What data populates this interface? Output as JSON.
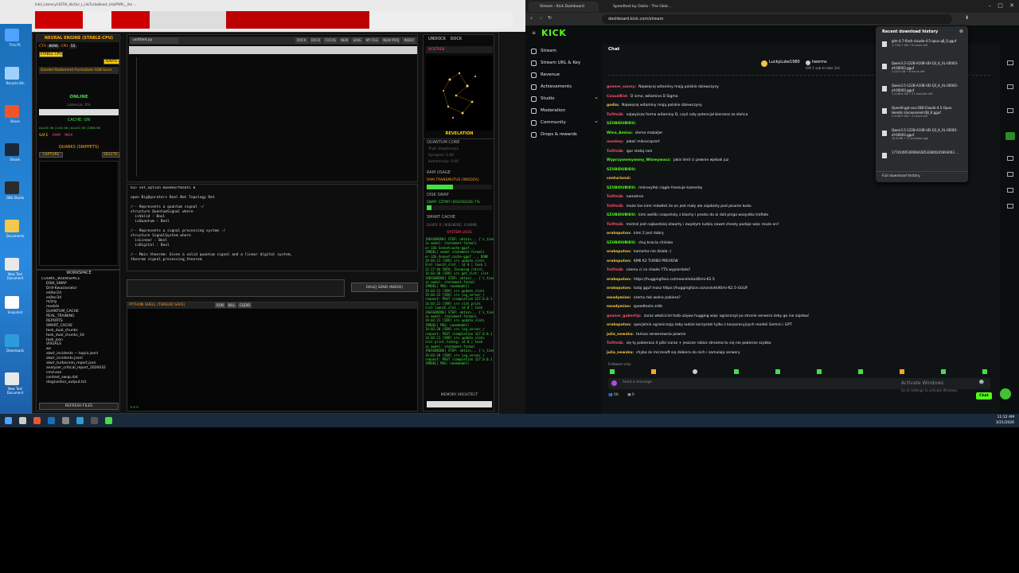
{
  "desktop": {
    "top_strip_text": "Intel_Latency/ULTRA_4k/Qsc_L_hk/TurboBoost_Lhb/PWR/__lite ..."
  },
  "desktop_icons": [
    {
      "label": "This PC",
      "color": "#4fa3ff"
    },
    {
      "label": "Recycle Bin",
      "color": "#9fd0ff"
    },
    {
      "label": "Brave",
      "color": "#f0542d"
    },
    {
      "label": "Steam",
      "color": "#1b2838"
    },
    {
      "label": "OBS Studio",
      "color": "#2b2b2b"
    },
    {
      "label": "Documents",
      "color": "#f2c94c"
    },
    {
      "label": "New Text Document",
      "color": "#e8e8e8"
    },
    {
      "label": "Snapshot",
      "color": "#ffffff"
    },
    {
      "label": "Downloads",
      "color": "#2d9cdb"
    },
    {
      "label": "New Text Document",
      "color": "#e8e8e8"
    }
  ],
  "workspace_app": {
    "neural_engine_title": "NEURAL ENGINE (STABLE-CPU)",
    "cpu_label": "CPU",
    "cpu_value": "55",
    "ctx_label": "CTX",
    "ctx_value": "8096",
    "stable_cpu": "STABLE CPU",
    "ignite": "IGNITE",
    "model_name": "Goedel-Statement-Formalizer-32B-Sonn",
    "status": "ONLINE",
    "latency": "Latencja: 0%",
    "cache_on": "CACHE: ON",
    "cache_stats": "ALLOC 0K  | LOG 0K | ALLOC 0K | DISK 0K",
    "safe": "SAFE",
    "ram": "RAM",
    "max": "MAX",
    "quarks_title": "QUARKS (SNIPPETS)",
    "capture": "CAPTURE",
    "delete": "DELETE",
    "workspace_title": "WORKSPACE",
    "tree": [
      "COSMIC_WORKSPACE",
      "DISK_SWAP",
      "Drill-Kwazionator",
      "editor2d",
      "editor3d",
      "m/zrg",
      "models",
      "QUANTUM_CACHE",
      "REAL_TRAINING",
      "REPORTS",
      "SMART_CACHE",
      "task_dual_chunks",
      "task_dual_chunks_3d",
      "task_json",
      "VISUALS",
      "ws",
      "alw/r_incidents — kopia.jsonl",
      "alw/r_incidents.jsonl",
      "alw/r_turbocsan_report.json",
      "analyzer_critical_report_2026032",
      "cmd.exe",
      "context_swap.dat",
      "diagnostics_output.txt"
    ],
    "refresh_files": "REFRESH FILES",
    "editor_tab": "untitled.py",
    "editor_buttons": [
      "DOCK",
      "DOCK",
      "FOCUS",
      "NEW",
      "SAVE",
      "MY FILE",
      "NEW PROJ",
      "INDEX"
    ],
    "lean_lines": [
      "AI> set_option maxHeartbeats 0",
      "",
      "open BigOperators Real Nat Topology Rat",
      "",
      "/-- Represents a quantum signal -/",
      "structure QuantumSignal where",
      "  isValid : Bool",
      "  isQuantum : Bool",
      "",
      "/-- Represents a signal processing system -/",
      "structure SignalSystem where",
      "  isLinear : Bool",
      "  isDigital : Bool",
      "",
      "/-- Main theorem: Given a valid quantum signal and a linear digital system,",
      "theorem signal_processing_theorem"
    ],
    "send_button": "DALEJ SEND (NDOO)",
    "shell_title": "PYTHON SHELL (THREAD SAFE)",
    "shell_buttons": [
      "RUN",
      "KILL",
      "CLEAR"
    ],
    "shell_prompt": ">>>",
    "undock": "UNDOCK",
    "dock": "DOCK",
    "actions": "ACKTREK",
    "revelation": "REVELATION",
    "quantum_core": "QUANTUM CORE",
    "quantum_rows": [
      "Tryb: Eksploracja",
      "Synapse: 0.00",
      "Koherencja: 0.00"
    ],
    "ram_usage": "RAM USAGE",
    "ram_transmutus": "RAM TRANSMUTUS (WIEDZA)",
    "disk_swap": "DISK SWAP",
    "swap_status": "SWAP: CZYWY (SOLFEGGIO) 7%",
    "smart_cache": "SMART CACHE",
    "smart_cache_val": "SLADY: 0 | WIELKOŚĆ: 0.00MB",
    "system_logs": "SYSTEM LOGS",
    "logs": [
      "[REASONING] STEP: obtain... {'s_tied",
      "ie model: statement-formali",
      "er-32b-Sonnetcache-gguf...",
      "[MODEL] model statement-formali",
      "er-32b-Sonnet:cache-gguf ... DONE",
      "19:03:21 [SRV] srv  update_slots",
      "Slot launch_slot_: id 0 | task 1",
      "12:17:44 INFO: Incoming retrol.",
      "14:03:20 [SRV] srv  get_slot: slot",
      "[REASONING] STEP: obtain... {'s_tied",
      "ie model: statement-formal",
      "[MODEL] MSG: nasmmodell",
      "19:03:21 [SRV] srv  update_slots",
      "19:03:23 [SRV] srv  log_server_r",
      "request: POST /completion 127.0.0.1",
      "14:03:21 [SRV] srv  slot_print",
      "slot launch_slot_: id 0 | task",
      "[REASONING] STEP: obtain... {'s_tied",
      "ie model: statement-formali",
      "19:03:21 [SRV] srv  update_slots",
      "[MODEL] MSG: nasmmodell",
      "14:03:20 [SRV] srv  log_server_r",
      "request: POST /completion 127.0.0.1",
      "14:03:21 [SRV] srv  update_slots",
      "slot print_timing: id 0 | task",
      "ie model: statement-formal",
      "[REASONING] STEP: obtain... {'s_tied",
      "19:03:20 [SRV] srv  log_server_r",
      "request: POST /completion 127.0.0.1",
      "[MODEL] MSG: nasmmodell"
    ],
    "memory_architect": "MEMORY ARCHITECT"
  },
  "browser": {
    "tabs": [
      {
        "label": "Stream - Kick Dashboard",
        "active": true
      },
      {
        "label": "Speedtest by Ookla - The Global Br...",
        "active": false
      }
    ],
    "url": "dashboard.kick.com/stream"
  },
  "kick": {
    "logo": "KICK",
    "nav": [
      {
        "label": "Stream",
        "chev": false
      },
      {
        "label": "Stream URL & Key",
        "chev": false
      },
      {
        "label": "Revenue",
        "chev": false
      },
      {
        "label": "Achievements",
        "chev": false
      },
      {
        "label": "Studio",
        "chev": true
      },
      {
        "label": "Moderation",
        "chev": false
      },
      {
        "label": "Community",
        "chev": true
      },
      {
        "label": "Drops & rewards",
        "chev": false
      }
    ],
    "chat_title": "Chat",
    "pinned_user": "LuckyLuke1980",
    "pinned_user2": "tworms",
    "pinned_sub": "Gift 1 sub to take 3rd",
    "messages": [
      {
        "user": "gooner_sunny:",
        "color": "#ff4d6d",
        "text": "Najwięcej witaminy mają polskie dziewczyny"
      },
      {
        "user": "CasualKid:",
        "color": "#ff4d6d",
        "text": "D simo, witamina D Sigma"
      },
      {
        "user": "godio:",
        "color": "#f5c242",
        "text": "Najwięcej witaminy mają polskie dziewczyny"
      },
      {
        "user": "ToOtniA:",
        "color": "#ff4d6d",
        "text": "najwyższa forma witaminy D, czyli cały potencjał bierzesz ze słońca"
      },
      {
        "user": "SZUBIDUBIDU:",
        "color": "#53fc18",
        "text": ""
      },
      {
        "user": "Wina_Amina:",
        "color": "#53fc18",
        "text": "słoma makaljer"
      },
      {
        "user": "monkey:",
        "color": "#ff4d6d",
        "text": "jebać mikroczprort"
      },
      {
        "user": "ToOtniA:",
        "color": "#ff4d6d",
        "text": "igor stałaj ram"
      },
      {
        "user": "Wyprzywomywony_Wlamywacz:",
        "color": "#53fc18",
        "text": "jakis limit ci pewnie wjebali juz"
      },
      {
        "user": "SZUBIDUBIDU:",
        "color": "#53fc18",
        "text": ""
      },
      {
        "user": "centurionsl:",
        "color": "#f5c242",
        "text": ""
      },
      {
        "user": "SZUBIDUBIDU:",
        "color": "#53fc18",
        "text": "mikrosyfek ciągle freezuje kamerkę"
      },
      {
        "user": "ToOtniA:",
        "color": "#ff4d6d",
        "text": "namotron"
      },
      {
        "user": "ToOtniA:",
        "color": "#ff4d6d",
        "text": "może tan kimi mówiłeś że on jest mały ale zajebisty pod pisanie kodu"
      },
      {
        "user": "SZUBIDUBIDU:",
        "color": "#53fc18",
        "text": "kimi wolliki snapshoty z blachy i prosto do ai dali pinga wszystko trafiało"
      },
      {
        "user": "ToOtniA:",
        "color": "#ff4d6d",
        "text": "mistral jest najbardziej otwarty i zwykłym ludzią nawet cheaty podaje więc może on?"
      },
      {
        "user": "orakoputon:",
        "color": "#f5c242",
        "text": "kimi 2 jest dobry"
      },
      {
        "user": "SZUBIDUBIDU:",
        "color": "#53fc18",
        "text": "chuj bracia chińsko"
      },
      {
        "user": "orakoputon:",
        "color": "#f5c242",
        "text": "kamerka nie działa :("
      },
      {
        "user": "orakoputon:",
        "color": "#f5c242",
        "text": "KIMI K2 TURBO PREVIEW"
      },
      {
        "user": "ToOtniA:",
        "color": "#ff4d6d",
        "text": "czemu ci co chwile TTS wypierdala?"
      },
      {
        "user": "orakoputon:",
        "color": "#f5c242",
        "text": "https://huggingface.co/moonshotai/Kimi-K2.5"
      },
      {
        "user": "orakoputon:",
        "color": "#f5c242",
        "text": "tutaj gguf masz https://huggingface.co/unsloth/Kimi-K2.5-GGUF"
      },
      {
        "user": "ewadymian:",
        "color": "#f5c242",
        "text": "czemu tak wolno pobiera?"
      },
      {
        "user": "ewadymian:",
        "color": "#f5c242",
        "text": "speedtesta zrób"
      },
      {
        "user": "gooner_gubertip:",
        "color": "#ff4d6d",
        "text": "zaraz właściciel tezb używa hugging więc ograniczył po stronie serwera żeby go nie zajebać"
      },
      {
        "user": "orakoputon:",
        "color": "#f5c242",
        "text": "specjalnie ograniczają żeby ludzie korzystali tylko z korporacyjnych modeli Gemini i GPT"
      },
      {
        "user": "julia_newska:",
        "color": "#f5c242",
        "text": "tańsza serwerownia pewnie"
      },
      {
        "user": "ToOtniA:",
        "color": "#ff4d6d",
        "text": "się ty pobierasz 4 pliki naraz + jeszcze robisz streama to się nie pobierze szybko"
      },
      {
        "user": "julia_newska:",
        "color": "#f5c242",
        "text": "chyba że microsoft się dobiera do nich i zamulają serwery"
      }
    ],
    "followers_only": "Followers only",
    "chat_placeholder": "Send a message",
    "chat_button": "Chat",
    "viewer_count": "00",
    "sub_count": "0",
    "downloads_title": "Recent download history",
    "downloads": [
      {
        "name": "glm-4.7-flash-claude-4.5-opus.q8_0.gguf",
        "meta": "1.7/30.7 GB • 6 hours left"
      },
      {
        "name": "Qwen3.5-122B-A10B-UD-Q3_K_XL-00003-of-00003.gguf",
        "meta": "1.0/21 GB • 6 hours left"
      },
      {
        "name": "Qwen3.5-122B-A10B-UD-Q3_K_XL-00002-of-00003.gguf",
        "meta": "1.2/46.8 GB • 27 minutes left"
      },
      {
        "name": "OpenAI-gpt-oss-20B-Claude-4.5-Opus-Heretic-Uncensored-Q8_K.gguf",
        "meta": "2.4/46.9 GB • 4 hours left"
      },
      {
        "name": "Qwen3.5-122B-A10B-UD-Q3_K_XL-00001-of-00003.gguf",
        "meta": "16.6 MB • 11 minutes ago"
      },
      {
        "name": "1774109530006428532800245693003 ...",
        "meta": ""
      }
    ],
    "full_history": "Full download history",
    "activate_title": "Activate Windows",
    "activate_sub": "Go to Settings to activate Windows."
  },
  "taskbar": {
    "time": "11:12 AM",
    "date": "3/21/2026"
  }
}
